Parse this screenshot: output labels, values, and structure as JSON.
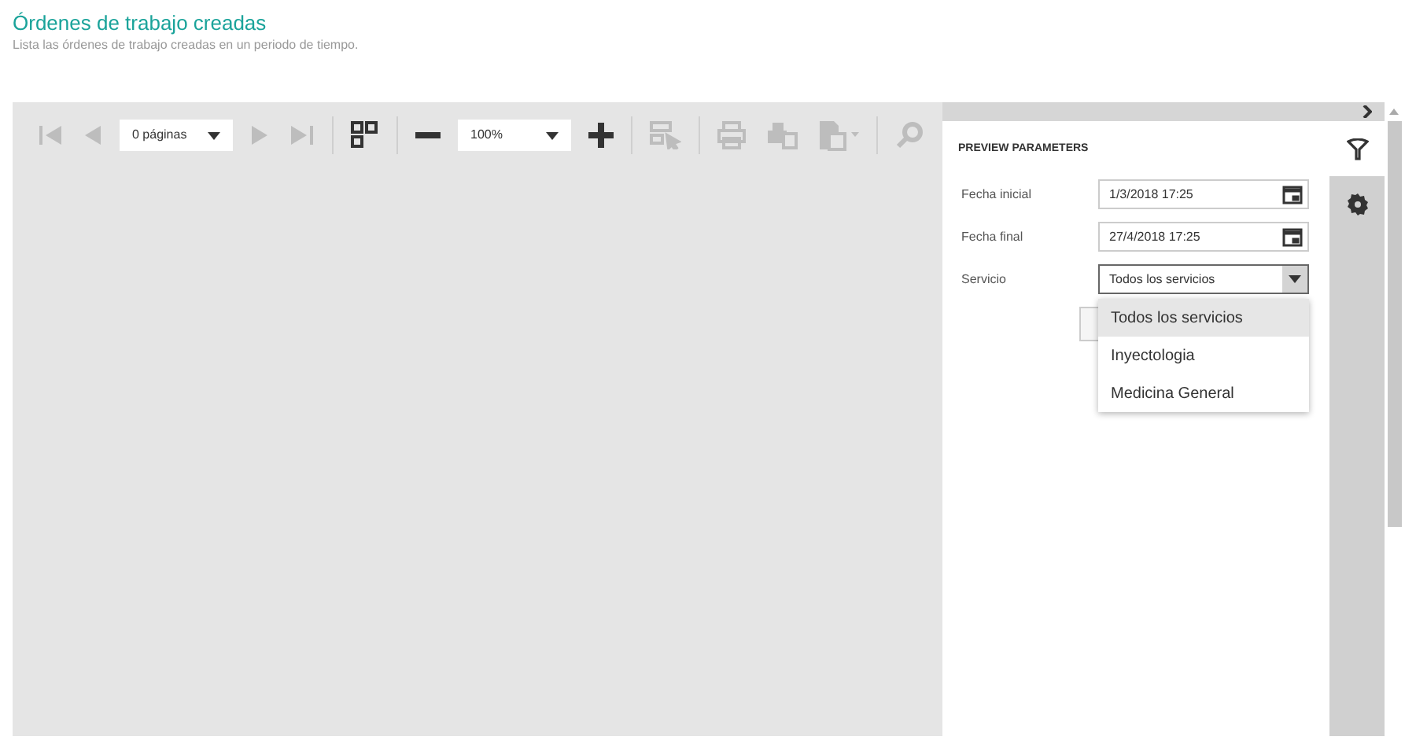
{
  "header": {
    "title": "Órdenes de trabajo creadas",
    "subtitle": "Lista las órdenes de trabajo creadas en un periodo de tiempo."
  },
  "toolbar": [
    {
      "kind": "first",
      "disabled": true
    },
    {
      "kind": "prev",
      "disabled": true
    },
    {
      "kind": "pages",
      "value": "0 páginas"
    },
    {
      "kind": "next",
      "disabled": true
    },
    {
      "kind": "last",
      "disabled": true
    },
    {
      "kind": "sep"
    },
    {
      "kind": "multipage",
      "disabled": false
    },
    {
      "kind": "sep"
    },
    {
      "kind": "zoomout",
      "disabled": false
    },
    {
      "kind": "zoom",
      "value": "100%"
    },
    {
      "kind": "zoomin",
      "disabled": false
    },
    {
      "kind": "sep"
    },
    {
      "kind": "highlight",
      "disabled": true
    },
    {
      "kind": "sep"
    },
    {
      "kind": "print",
      "disabled": true
    },
    {
      "kind": "printpage",
      "disabled": true
    },
    {
      "kind": "export",
      "disabled": true
    },
    {
      "kind": "sep"
    },
    {
      "kind": "search",
      "disabled": true
    }
  ],
  "panel": {
    "title": "PREVIEW PARAMETERS",
    "parameters": [
      {
        "kind": "date",
        "label": "Fecha inicial",
        "value": "1/3/2018 17:25"
      },
      {
        "kind": "date",
        "label": "Fecha final",
        "value": "27/4/2018 17:25"
      },
      {
        "kind": "select",
        "label": "Servicio",
        "value": "Todos los servicios",
        "expanded": true,
        "options": [
          {
            "label": "Todos los servicios",
            "selected": true
          },
          {
            "label": "Inyectologia",
            "selected": false
          },
          {
            "label": "Medicina General",
            "selected": false
          }
        ]
      }
    ]
  },
  "side_tabs": [
    {
      "kind": "filter",
      "selected": true
    },
    {
      "kind": "settings",
      "selected": false
    }
  ]
}
